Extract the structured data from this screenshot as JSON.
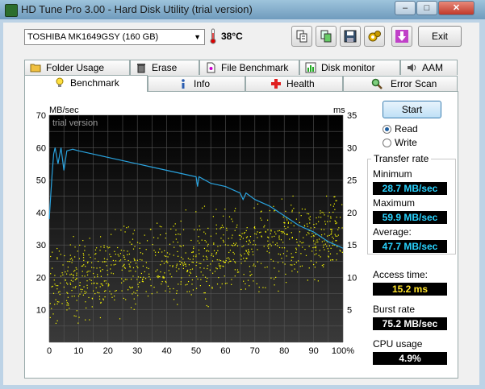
{
  "window": {
    "title": "HD Tune Pro 3.00 - Hard Disk Utility (trial version)"
  },
  "toolbar": {
    "drive": "TOSHIBA MK1649GSY (160 GB)",
    "temperature": "38°C",
    "exit_label": "Exit"
  },
  "tabs_top": [
    "Folder Usage",
    "Erase",
    "File Benchmark",
    "Disk monitor",
    "AAM"
  ],
  "tabs_bottom": [
    "Benchmark",
    "Info",
    "Health",
    "Error Scan"
  ],
  "controls": {
    "start_label": "Start",
    "read_label": "Read",
    "write_label": "Write",
    "mode_selected": "Read"
  },
  "results": {
    "transfer_rate_label": "Transfer rate",
    "minimum_label": "Minimum",
    "minimum": "28.7 MB/sec",
    "maximum_label": "Maximum",
    "maximum": "59.9 MB/sec",
    "average_label": "Average:",
    "average": "47.7 MB/sec",
    "access_label": "Access time:",
    "access": "15.2 ms",
    "burst_label": "Burst rate",
    "burst": "75.2 MB/sec",
    "cpu_label": "CPU usage",
    "cpu": "4.9%"
  },
  "chart_data": {
    "type": "line",
    "watermark": "trial version",
    "y_left_label": "MB/sec",
    "y_right_label": "ms",
    "y_left_ticks": [
      10,
      20,
      30,
      40,
      50,
      60,
      70
    ],
    "y_right_ticks": [
      5,
      10,
      15,
      20,
      25,
      30,
      35
    ],
    "x_ticks": [
      "0",
      "10",
      "20",
      "30",
      "40",
      "50",
      "60",
      "70",
      "80",
      "90",
      "100%"
    ],
    "ylim": [
      0,
      70
    ],
    "y2lim": [
      0,
      35
    ],
    "xlim": [
      0,
      100
    ],
    "grid": true,
    "colors": {
      "transfer": "#2aa4e0",
      "access": "#ffff00",
      "background": "#000000"
    },
    "series": [
      {
        "x": [
          0,
          1,
          1.5,
          2,
          3,
          4,
          5,
          6,
          8,
          10,
          15,
          20,
          25,
          30,
          35,
          40,
          45,
          50,
          50.5,
          51,
          55,
          60,
          65,
          66,
          67,
          70,
          75,
          80,
          85,
          90,
          95,
          100
        ],
        "values": [
          38,
          52,
          58,
          60,
          55,
          60,
          53,
          59,
          59.5,
          59,
          58,
          57,
          56,
          55,
          54,
          53,
          52,
          51,
          48,
          51,
          49,
          48,
          46,
          44,
          46,
          44,
          42,
          39,
          36,
          34,
          31,
          29
        ]
      },
      {
        "type": "scatter",
        "name": "Access time",
        "x_range": [
          0,
          100
        ],
        "y_range_ms": [
          3,
          26
        ],
        "points": 1000
      }
    ]
  }
}
